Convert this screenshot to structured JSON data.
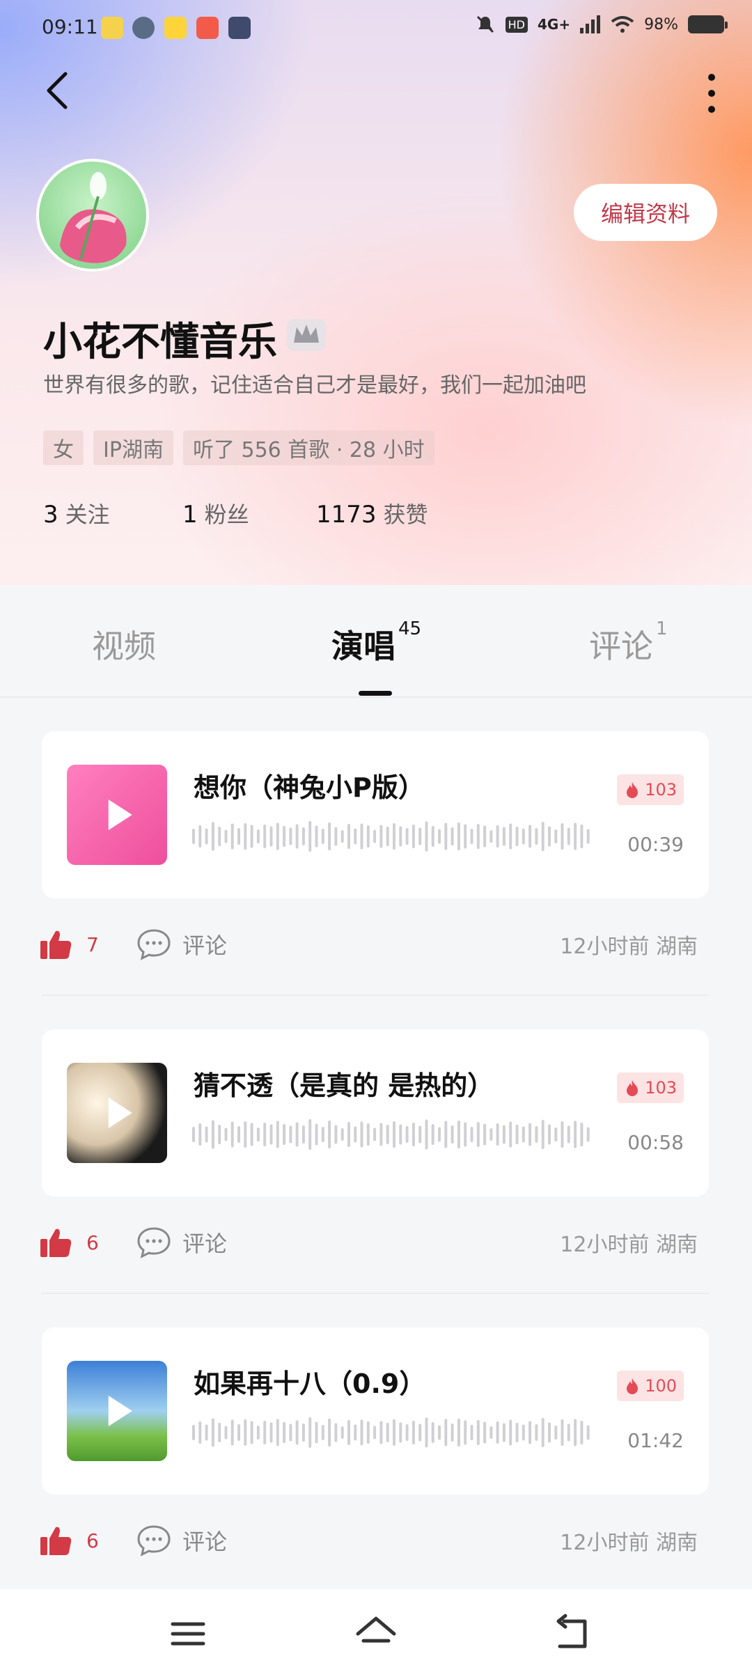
{
  "status_bar": {
    "time": "09:11",
    "battery": "98%",
    "network": "4G+"
  },
  "profile": {
    "nickname": "小花不懂音乐",
    "bio": "世界有很多的歌，记住适合自己才是最好，我们一起加油吧",
    "edit_button": "编辑资料",
    "tags": [
      "女",
      "IP湖南",
      "听了 556 首歌 · 28 小时"
    ],
    "stats": [
      {
        "value": "3",
        "label": "关注"
      },
      {
        "value": "1",
        "label": "粉丝"
      },
      {
        "value": "1173",
        "label": "获赞"
      }
    ]
  },
  "tabs": [
    {
      "label": "视频",
      "count": ""
    },
    {
      "label": "演唱",
      "count": "45"
    },
    {
      "label": "评论",
      "count": "1"
    }
  ],
  "songs": [
    {
      "title": "想你（神兔小P版）",
      "heat": "103",
      "duration": "00:39",
      "likes": "7",
      "comment_label": "评论",
      "meta": "12小时前 湖南"
    },
    {
      "title": "猜不透（是真的 是热的）",
      "heat": "103",
      "duration": "00:58",
      "likes": "6",
      "comment_label": "评论",
      "meta": "12小时前 湖南"
    },
    {
      "title": "如果再十八（0.9）",
      "heat": "100",
      "duration": "01:42",
      "likes": "6",
      "comment_label": "评论",
      "meta": "12小时前 湖南"
    }
  ],
  "colors": {
    "accent": "#d23a45",
    "heat_bg": "#fce3e4",
    "edit_text": "#c23a4a"
  },
  "icons": [
    "back-icon",
    "more-icon",
    "crown-icon",
    "like-icon",
    "comment-icon",
    "fire-icon",
    "play-icon",
    "menu-icon",
    "home-icon",
    "back-nav-icon"
  ]
}
